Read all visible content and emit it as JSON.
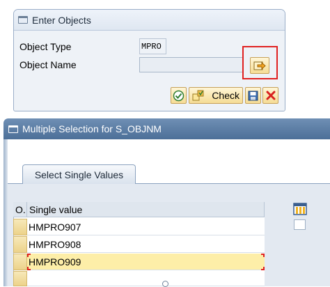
{
  "dialog1": {
    "title": "Enter Objects",
    "object_type_label": "Object Type",
    "object_type_value": "MPRO",
    "object_name_label": "Object Name",
    "object_name_value": "",
    "check_label": "Check"
  },
  "dialog2": {
    "title": "Multiple Selection for S_OBJNM",
    "tab_label": "Select Single Values",
    "columns": [
      "O.",
      "Single value"
    ],
    "rows": [
      "HMPRO907",
      "HMPRO908",
      "HMPRO909",
      ""
    ]
  },
  "colors": {
    "highlight_row": "#fdeea8",
    "annotation_red": "#e02020",
    "title_bar_blue": "#4c6f98"
  },
  "icons": [
    "window-icon",
    "navigate-arrow-icon",
    "continue-icon",
    "check-icon",
    "save-icon",
    "cancel-icon",
    "table-settings-icon"
  ]
}
